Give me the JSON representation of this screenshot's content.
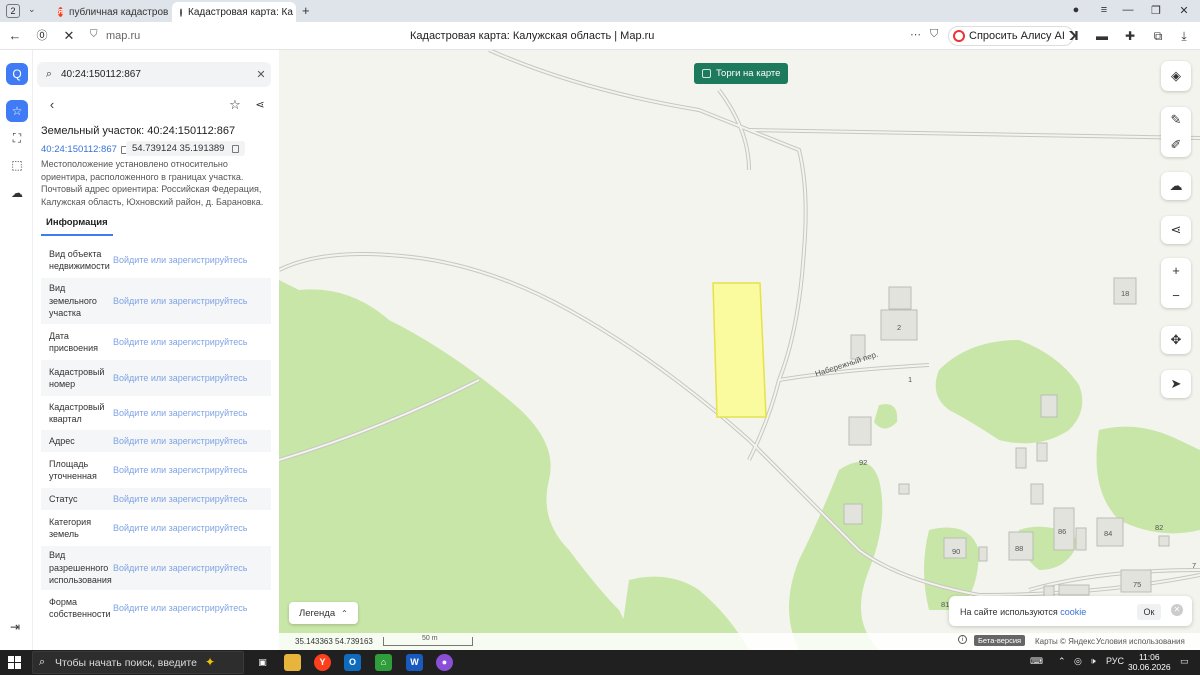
{
  "browser": {
    "tab_count": "2",
    "tabs": [
      {
        "label": "публичная кадастровая к"
      },
      {
        "label": "Кадастровая карта: Ка"
      }
    ],
    "url_host": "map.ru",
    "page_title": "Кадастровая карта: Калужская область | Map.ru",
    "alice_label": "Спросить Алису AI"
  },
  "panel": {
    "search_value": "40:24:150112:867",
    "title": "Земельный участок: 40:24:150112:867",
    "code": "40:24:150112:867",
    "coords": "54.739124 35.191389",
    "description": "Местоположение установлено относительно ориентира, расположенного в границах участка. Почтовый адрес ориентира: Российская Федерация, Калужская область, Юхновский район, д. Барановка.",
    "tab": "Информация",
    "rows": [
      {
        "label": "Вид объекта недвижимости",
        "value": "Войдите или зарегистрируйтесь"
      },
      {
        "label": "Вид земельного участка",
        "value": "Войдите или зарегистрируйтесь"
      },
      {
        "label": "Дата присвоения",
        "value": "Войдите или зарегистрируйтесь"
      },
      {
        "label": "Кадастровый номер",
        "value": "Войдите или зарегистрируйтесь"
      },
      {
        "label": "Кадастровый квартал",
        "value": "Войдите или зарегистрируйтесь"
      },
      {
        "label": "Адрес",
        "value": "Войдите или зарегистрируйтесь"
      },
      {
        "label": "Площадь уточненная",
        "value": "Войдите или зарегистрируйтесь"
      },
      {
        "label": "Статус",
        "value": "Войдите или зарегистрируйтесь"
      },
      {
        "label": "Категория земель",
        "value": "Войдите или зарегистрируйтесь"
      },
      {
        "label": "Вид разрешенного использования",
        "value": "Войдите или зарегистрируйтесь"
      },
      {
        "label": "Форма собственности",
        "value": "Войдите или зарегистрируйтесь"
      }
    ]
  },
  "map": {
    "torgi_label": "Торги на карте",
    "legend_label": "Легенда",
    "coords_readout": "35.143363   54.739163",
    "scale_label": "50 m",
    "beta_label": "Бета-версия",
    "copyright": "Карты © Яндекс",
    "terms": "Условия использования",
    "street_label": "Набережный пер.",
    "house_numbers": [
      "2",
      "1",
      "18",
      "92",
      "90",
      "88",
      "86",
      "84",
      "82",
      "81",
      "75",
      "7"
    ],
    "cookie_text": "На сайте используются ",
    "cookie_link": "cookie",
    "cookie_ok": "Ок",
    "parcel_color": "#fafa9e",
    "forest_color": "#c8e6a7"
  },
  "taskbar": {
    "search_placeholder": "Чтобы начать поиск, введите",
    "lang": "РУС",
    "time": "11:06",
    "date": "30.06.2026"
  }
}
